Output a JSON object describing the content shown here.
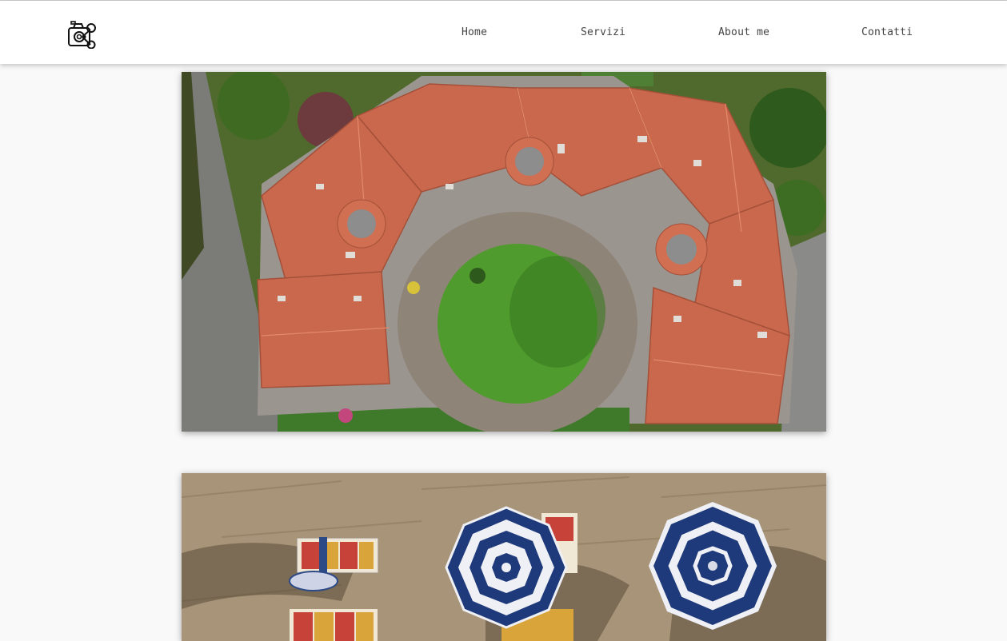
{
  "nav": {
    "logo_icon": "camera-drone-logo-icon",
    "items": [
      {
        "label": "Home"
      },
      {
        "label": "Servizi"
      },
      {
        "label": "About me"
      },
      {
        "label": "Contatti"
      }
    ]
  },
  "gallery": {
    "photos": [
      {
        "subject": "aerial-building-with-round-courtyard"
      },
      {
        "subject": "aerial-beach-umbrellas"
      }
    ]
  },
  "colors": {
    "background": "#f9f9f9",
    "navbar": "#ffffff",
    "nav_text": "#444444",
    "roof_terracotta": "#c9684c",
    "umbrella_blue": "#1f3a7a"
  }
}
